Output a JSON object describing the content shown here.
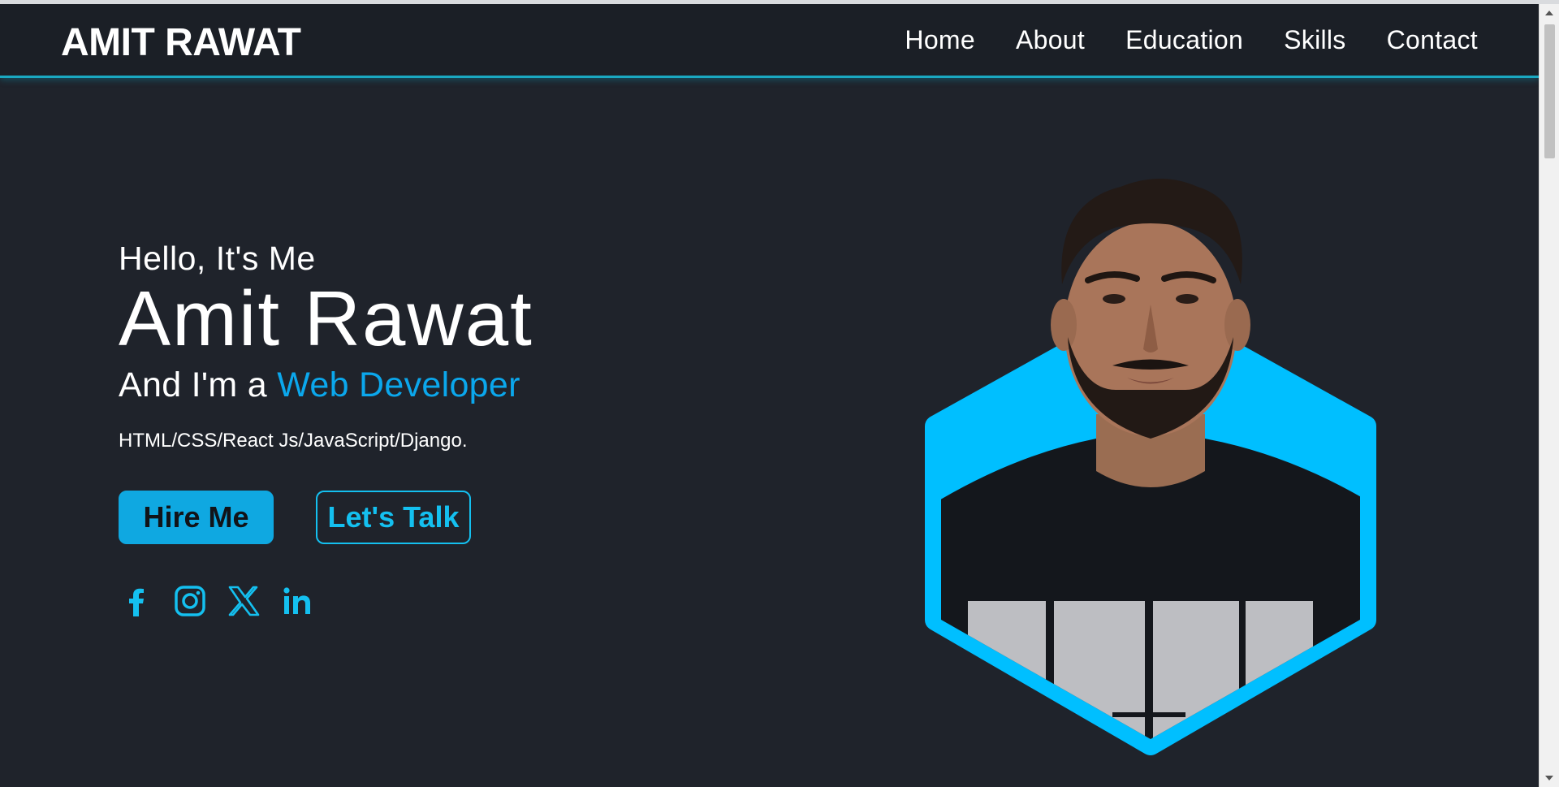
{
  "header": {
    "logo": "AMIT RAWAT",
    "nav": [
      {
        "label": "Home"
      },
      {
        "label": "About"
      },
      {
        "label": "Education"
      },
      {
        "label": "Skills"
      },
      {
        "label": "Contact"
      }
    ]
  },
  "hero": {
    "greeting": "Hello, It's Me",
    "name": "Amit Rawat",
    "role_prefix": "And I'm a",
    "role_highlight": "Web Developer",
    "tech": "HTML/CSS/React Js/JavaScript/Django.",
    "primary_button": "Hire Me",
    "secondary_button": "Let's Talk"
  },
  "socials": [
    {
      "icon": "facebook-icon"
    },
    {
      "icon": "instagram-icon"
    },
    {
      "icon": "x-twitter-icon"
    },
    {
      "icon": "linkedin-icon"
    }
  ],
  "colors": {
    "background": "#1f232b",
    "header": "#1b1f26",
    "accent": "#0ba7ec",
    "hexagon": "#00bfff",
    "header_border": "#1aa8c1"
  }
}
